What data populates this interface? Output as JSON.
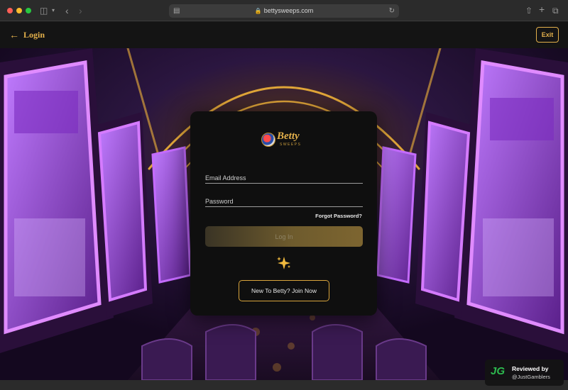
{
  "browser": {
    "url": "bettysweeps.com"
  },
  "header": {
    "title": "Login",
    "exit_label": "Exit"
  },
  "logo": {
    "name": "Betty",
    "sub": "SWEEPS"
  },
  "form": {
    "email_placeholder": "Email Address",
    "email_value": "",
    "password_placeholder": "Password",
    "password_value": "",
    "forgot_label": "Forgot Password?",
    "login_label": "Log In",
    "join_label": "New To Betty? Join Now"
  },
  "badge": {
    "label": "Reviewed by",
    "handle": "@JustGamblers",
    "icon_text": "JG"
  },
  "colors": {
    "accent_gold": "#e3b04b",
    "modal_bg": "#0f0f0f",
    "neon_purple": "#b23cff"
  },
  "icons": [
    "back-arrow-icon",
    "lock-icon",
    "sidebar-toggle-icon",
    "share-icon",
    "new-tab-icon",
    "tabs-overview-icon",
    "reload-icon",
    "sparkle-icon",
    "logo-badge-icon"
  ]
}
